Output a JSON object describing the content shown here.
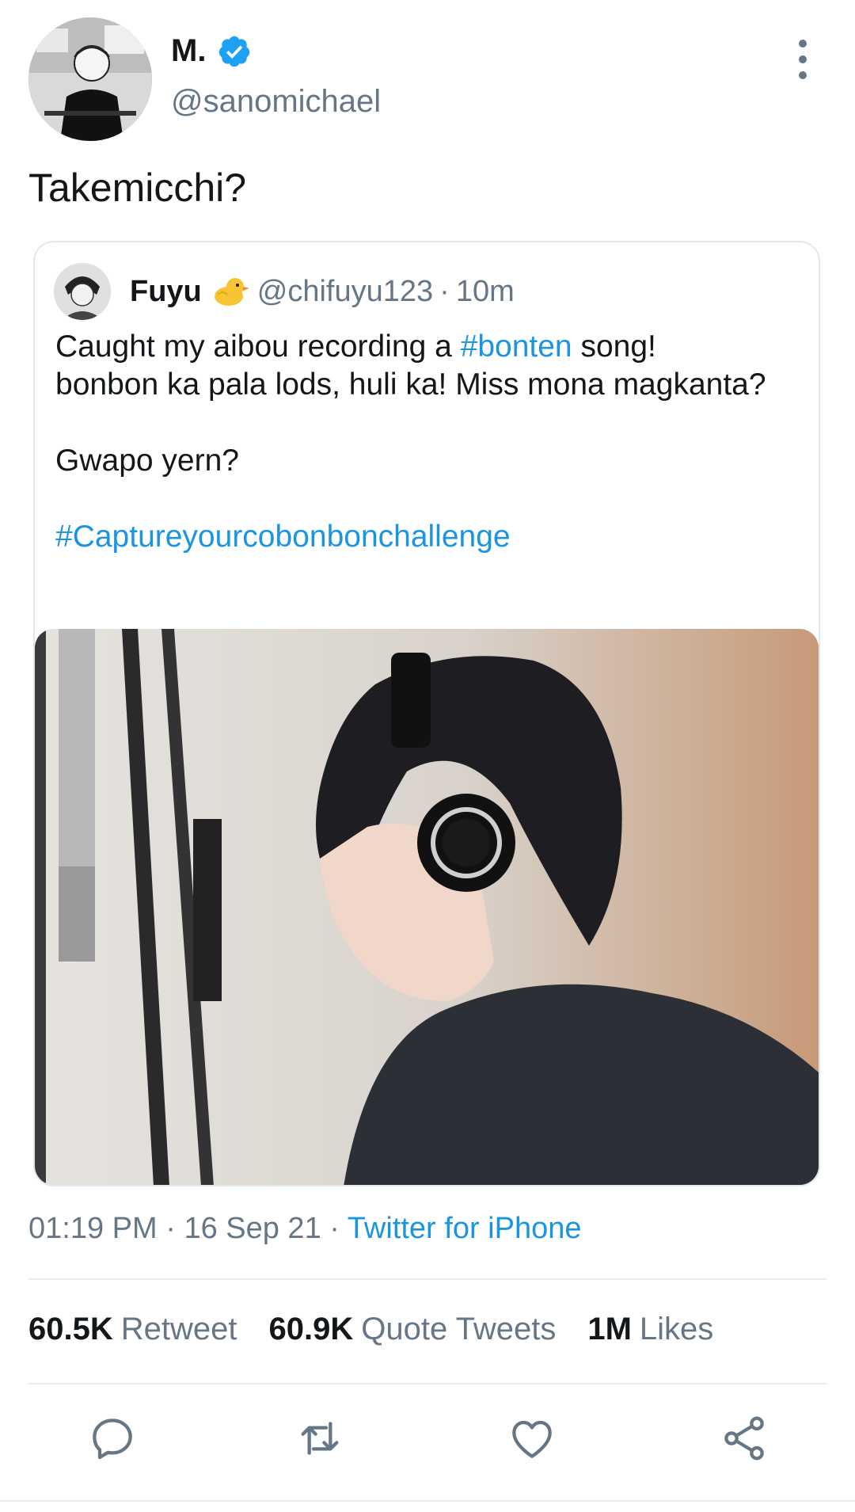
{
  "author": {
    "name": "M.",
    "handle": "@sanomichael",
    "verified": true,
    "verified_color": "#1da1f2"
  },
  "tweet": {
    "text": "Takemicchi?"
  },
  "quoted_tweet": {
    "name": "Fuyu",
    "emoji": "chick-emoji",
    "handle": "@chifuyu123",
    "separator": "·",
    "time": "10m",
    "line1_before": "Caught my aibou recording a ",
    "line1_hashtag": "#bonten",
    "line1_after": " song!",
    "line2": "bonbon ka pala lods, huli ka! Miss mona magkanta?",
    "line3": "Gwapo yern?",
    "hashtag": "#Captureyourcobonbonchallenge",
    "media_description_icon": "photo-person-headphones-microphone"
  },
  "meta": {
    "time": "01:19 PM",
    "separator": "·",
    "date": "16 Sep 21",
    "source": "Twitter for iPhone"
  },
  "stats": {
    "retweets_count": "60.5K",
    "retweets_label": "Retweet",
    "quotes_count": "60.9K",
    "quotes_label": "Quote Tweets",
    "likes_count": "1M",
    "likes_label": "Likes"
  },
  "actions": [
    "reply-icon",
    "retweet-icon",
    "like-icon",
    "share-icon"
  ],
  "colors": {
    "link": "#1b95e0",
    "secondary_text": "#657786",
    "primary_text": "#14171a",
    "border": "#e1e8ed"
  }
}
